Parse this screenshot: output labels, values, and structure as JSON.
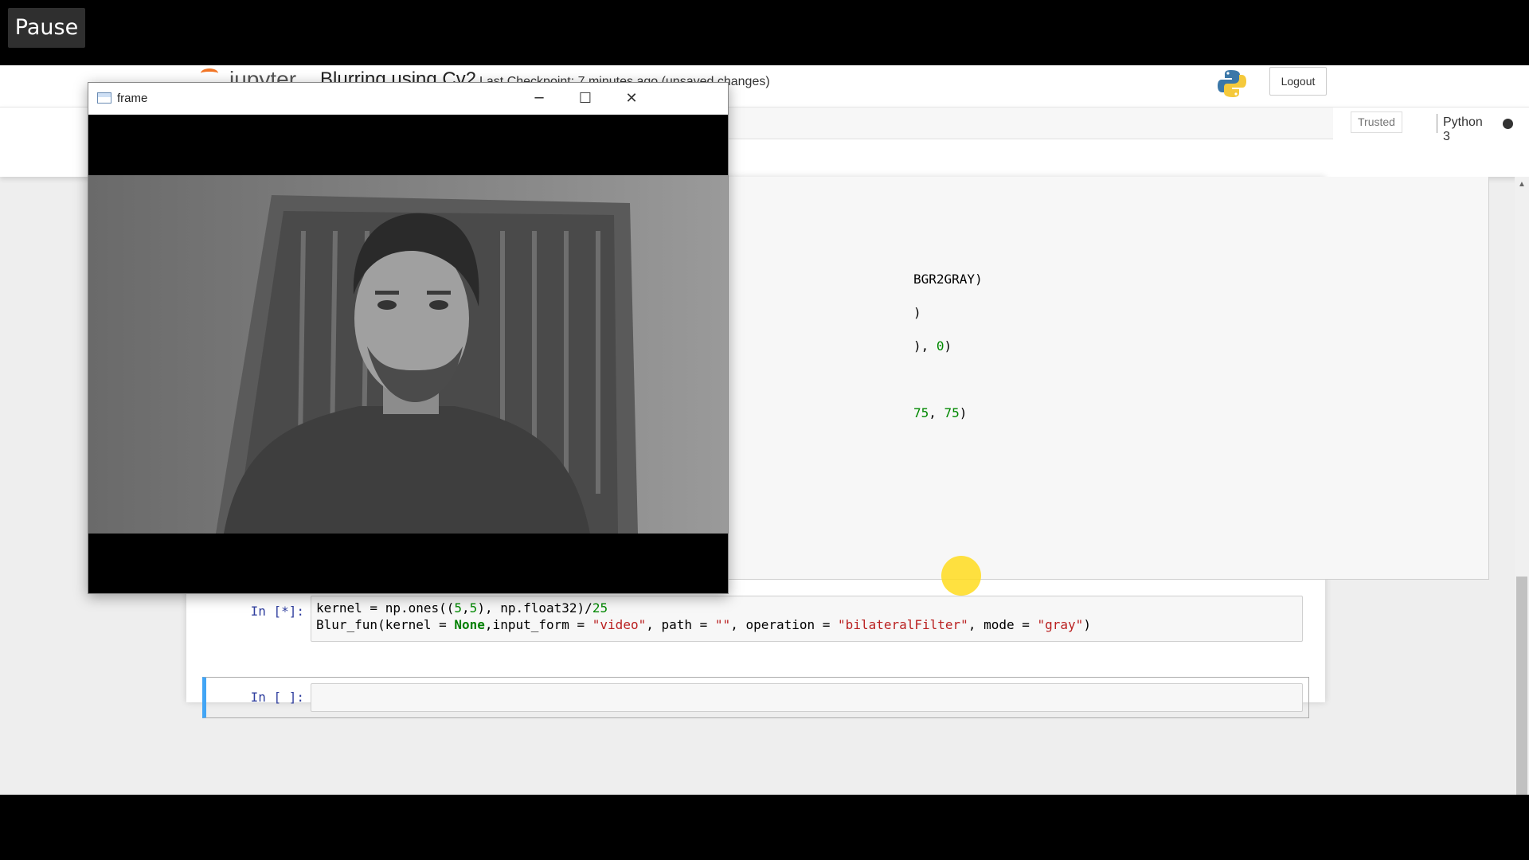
{
  "player": {
    "pause_label": "Pause"
  },
  "jupyter": {
    "brand": "jupyter",
    "notebook_title": "Blurring using Cv2",
    "checkpoint": "Last Checkpoint: 7 minutes ago  (unsaved changes)",
    "logout_label": "Logout",
    "trusted_label": "Trusted",
    "kernel_name": "Python 3"
  },
  "code_fragments": {
    "line1": "BGR2GRAY)",
    "line2": ")",
    "line3_a": "), ",
    "line3_b": "0",
    "line3_c": ")",
    "line4_a": "75",
    "line4_b": ", ",
    "line4_c": "75",
    "line4_d": ")"
  },
  "cells": [
    {
      "prompt": "In [*]:",
      "line1": {
        "a": "kernel = np.ones((",
        "b": "5",
        "c": ",",
        "d": "5",
        "e": "), np.float32)/",
        "f": "25"
      },
      "line2": {
        "a": "Blur_fun(kernel = ",
        "b": "None",
        "c": ",input_form = ",
        "d": "\"video\"",
        "e": ", path = ",
        "f": "\"\"",
        "g": ", operation = ",
        "h": "\"bilateralFilter\"",
        "i": ", mode = ",
        "j": "\"gray\"",
        "k": ")"
      }
    },
    {
      "prompt": "In [ ]:",
      "content": ""
    }
  ],
  "cv_window": {
    "title": "frame"
  }
}
